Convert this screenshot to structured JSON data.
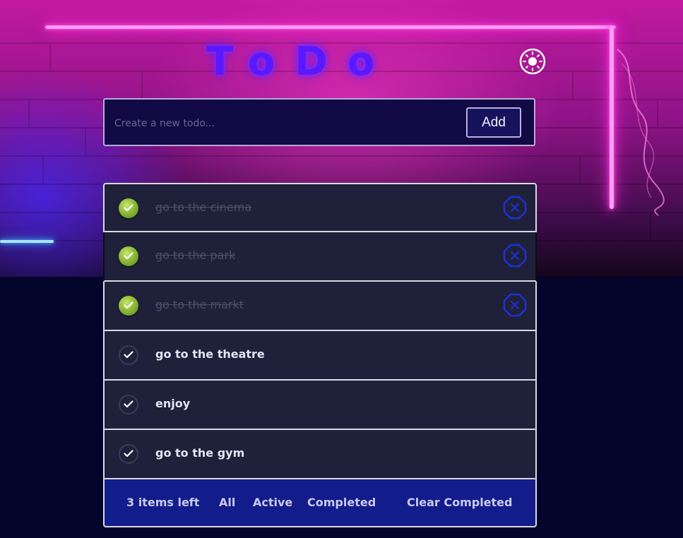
{
  "header": {
    "title": "ToDo",
    "theme_toggle_icon": "sun-icon"
  },
  "new_todo": {
    "placeholder": "Create a new todo...",
    "value": "",
    "add_label": "Add"
  },
  "todos": [
    {
      "text": "go to the cinema",
      "completed": true
    },
    {
      "text": "go to the park",
      "completed": true
    },
    {
      "text": "go to the markt",
      "completed": true
    },
    {
      "text": "go to the theatre",
      "completed": false
    },
    {
      "text": "enjoy",
      "completed": false
    },
    {
      "text": "go to the gym",
      "completed": false
    }
  ],
  "footer": {
    "items_left": "3 items left",
    "filter_all": "All",
    "filter_active": "Active",
    "filter_completed": "Completed",
    "clear_completed": "Clear Completed"
  },
  "colors": {
    "accent": "#5a18ff",
    "completed_check": "#8fb93a",
    "remove_icon": "#1f2fd6",
    "footer_bg": "#121c8a",
    "neon_pink": "#ff2bd8"
  }
}
